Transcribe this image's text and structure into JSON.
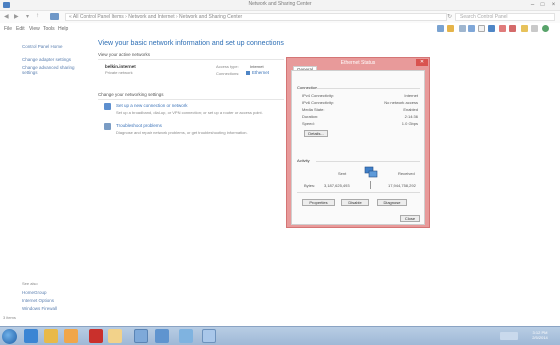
{
  "window": {
    "title": "Network and Sharing Center",
    "controls": [
      "–",
      "□",
      "×"
    ]
  },
  "address": {
    "path": "« All Control Panel Items › Network and Internet › Network and Sharing Center",
    "search_placeholder": "Search Control Panel"
  },
  "menu": [
    "File",
    "Edit",
    "View",
    "Tools",
    "Help"
  ],
  "left_pane": {
    "items": [
      "Control Panel Home",
      "Change adapter settings",
      "Change advanced sharing settings"
    ],
    "see_also_title": "See also",
    "see_also": [
      "HomeGroup",
      "Internet Options",
      "Windows Firewall"
    ]
  },
  "main": {
    "heading": "View your basic network information and set up connections",
    "active_label": "View your active networks",
    "network_name": "belkin.internet",
    "network_type": "Private network",
    "access_type_label": "Access type:",
    "access_type_value": "Internet",
    "connections_label": "Connections:",
    "connections_value": "Ethernet",
    "change_label": "Change your networking settings",
    "task1_title": "Set up a new connection or network",
    "task1_desc": "Set up a broadband, dial-up, or VPN connection; or set up a router or access point.",
    "task2_title": "Troubleshoot problems",
    "task2_desc": "Diagnose and repair network problems, or get troubleshooting information."
  },
  "dialog": {
    "title": "Ethernet Status",
    "tab": "General",
    "connection_title": "Connection",
    "rows": [
      {
        "label": "IPv4 Connectivity:",
        "value": "Internet"
      },
      {
        "label": "IPv6 Connectivity:",
        "value": "No network access"
      },
      {
        "label": "Media State:",
        "value": "Enabled"
      },
      {
        "label": "Duration:",
        "value": "2:14:36"
      },
      {
        "label": "Speed:",
        "value": "1.0 Gbps"
      }
    ],
    "details_button": "Details...",
    "activity_title": "Activity",
    "sent_label": "Sent",
    "received_label": "Received",
    "bytes_label": "Bytes:",
    "bytes_sent": "3,187,625,493",
    "bytes_received": "17,944,758,292",
    "buttons": [
      "Properties",
      "Disable",
      "Diagnose"
    ],
    "close_button": "Close"
  },
  "status_bar": {
    "left": "3 items"
  },
  "taskbar": {
    "apps": [
      "Internet Explorer",
      "File Explorer",
      "Media",
      "Office",
      "Paint",
      "Network"
    ],
    "time": "3:12 PM",
    "date": "2/5/2014"
  },
  "colors": {
    "dialog_frame": "#e89a9a",
    "taskbar": "#a9c0dc",
    "link": "#3b73b9",
    "heading": "#2e6fb5"
  }
}
